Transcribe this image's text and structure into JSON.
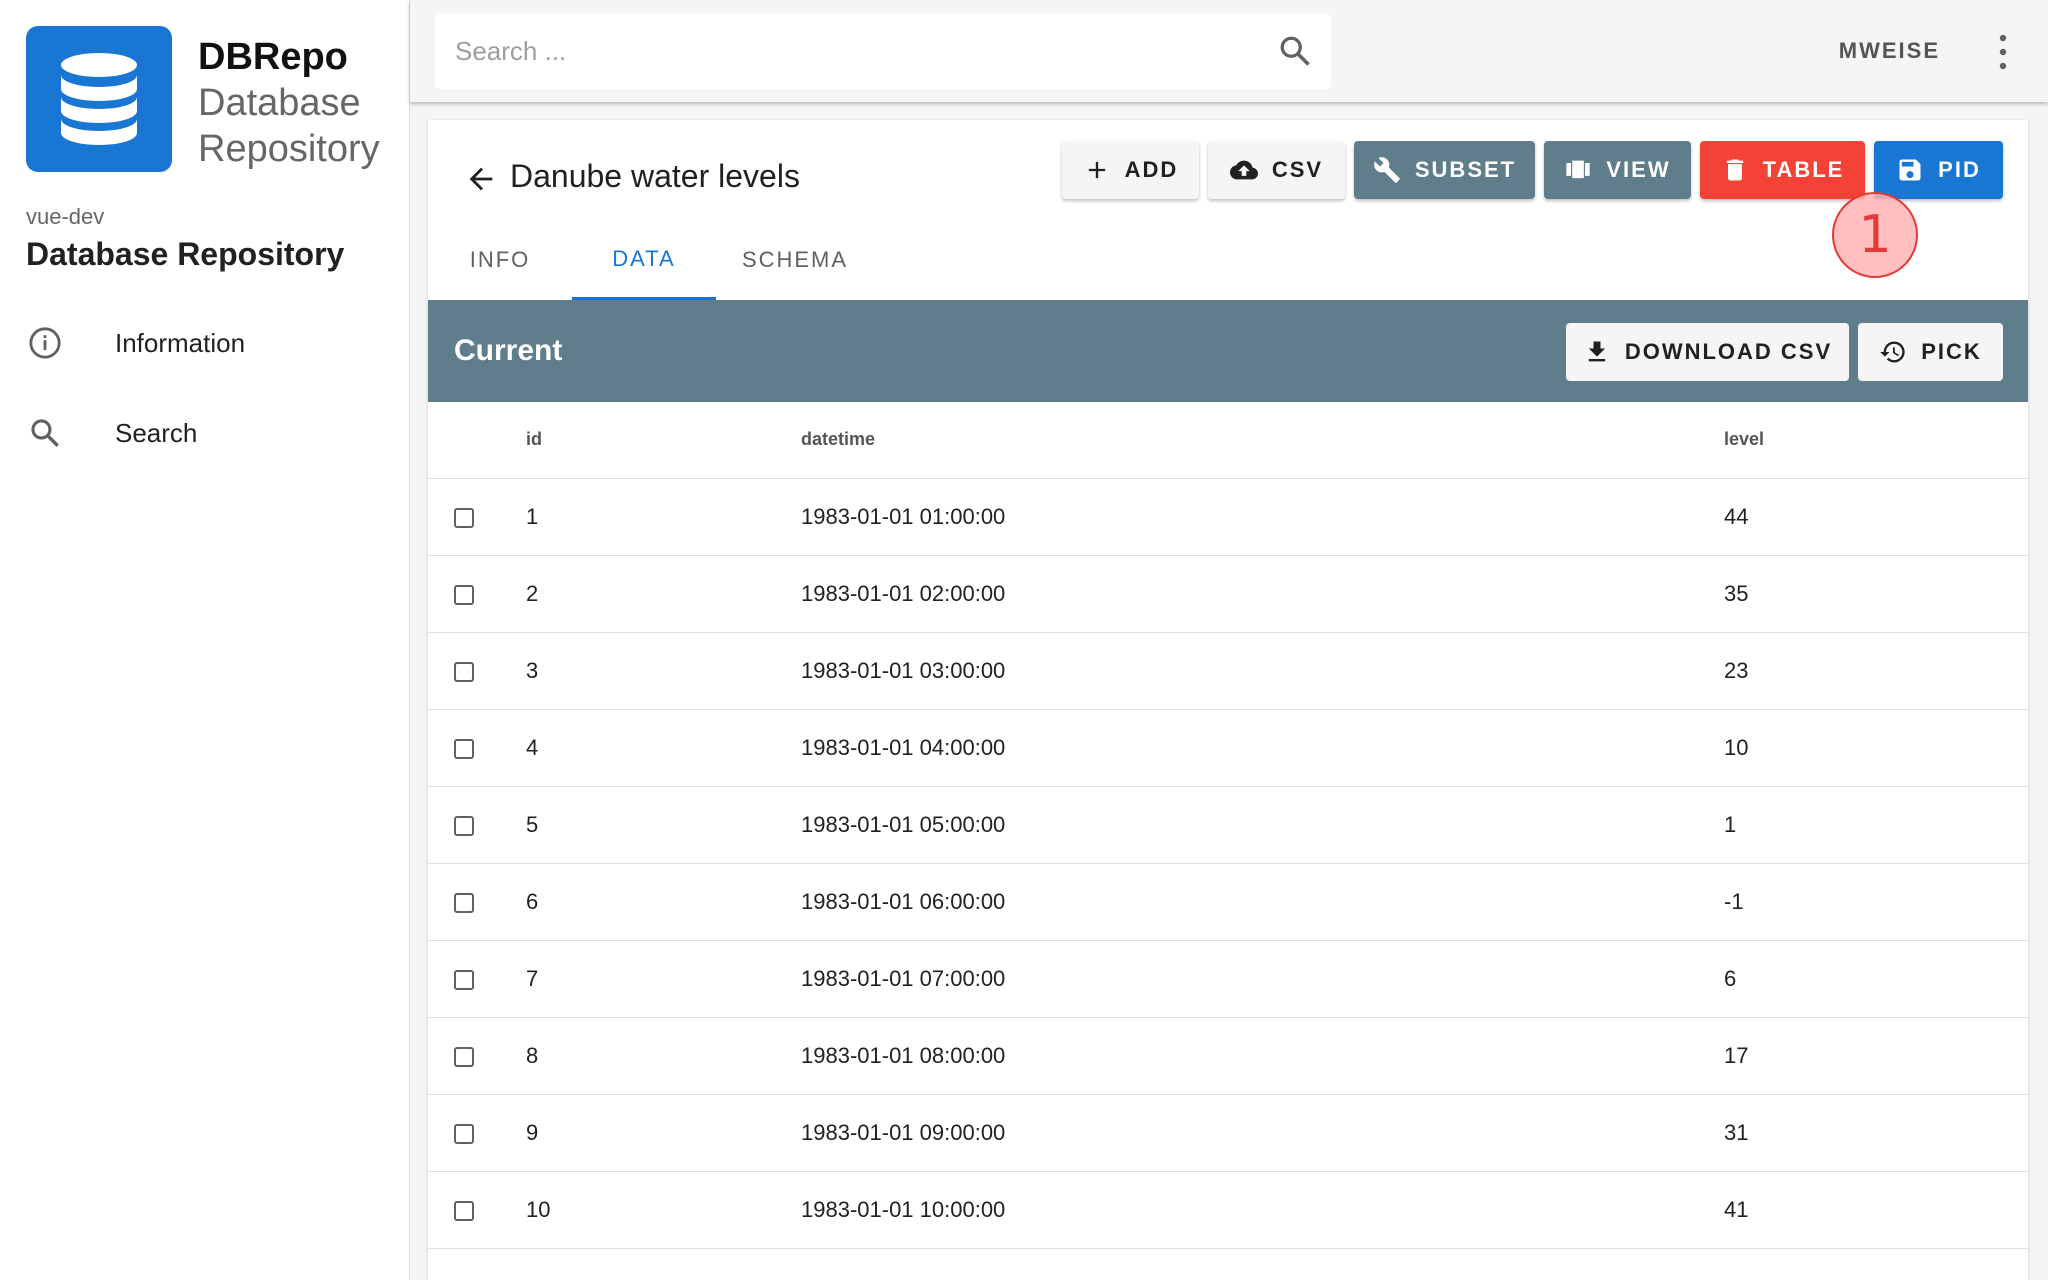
{
  "sidebar": {
    "brand_title": "DBRepo",
    "brand_sub1": "Database",
    "brand_sub2": "Repository",
    "env": "vue-dev",
    "repo_title": "Database Repository",
    "items": [
      {
        "label": "Information",
        "icon": "info-icon"
      },
      {
        "label": "Search",
        "icon": "search-icon"
      }
    ]
  },
  "topbar": {
    "search_placeholder": "Search ...",
    "user": "MWEISE"
  },
  "header": {
    "title": "Danube water levels",
    "buttons": {
      "add": "ADD",
      "csv": "CSV",
      "subset": "SUBSET",
      "view": "VIEW",
      "table": "TABLE",
      "pid": "PID"
    },
    "annotation": "1"
  },
  "tabs": [
    "INFO",
    "DATA",
    "SCHEMA"
  ],
  "panel": {
    "title": "Current",
    "download": "DOWNLOAD CSV",
    "pick": "PICK"
  },
  "table": {
    "columns": [
      "id",
      "datetime",
      "level"
    ],
    "rows": [
      [
        "1",
        "1983-01-01 01:00:00",
        "44"
      ],
      [
        "2",
        "1983-01-01 02:00:00",
        "35"
      ],
      [
        "3",
        "1983-01-01 03:00:00",
        "23"
      ],
      [
        "4",
        "1983-01-01 04:00:00",
        "10"
      ],
      [
        "5",
        "1983-01-01 05:00:00",
        "1"
      ],
      [
        "6",
        "1983-01-01 06:00:00",
        "-1"
      ],
      [
        "7",
        "1983-01-01 07:00:00",
        "6"
      ],
      [
        "8",
        "1983-01-01 08:00:00",
        "17"
      ],
      [
        "9",
        "1983-01-01 09:00:00",
        "31"
      ],
      [
        "10",
        "1983-01-01 10:00:00",
        "41"
      ]
    ]
  },
  "colors": {
    "primary": "#1976d2",
    "slate": "#607d8b",
    "danger": "#f44336",
    "annotation": "#e53935"
  }
}
